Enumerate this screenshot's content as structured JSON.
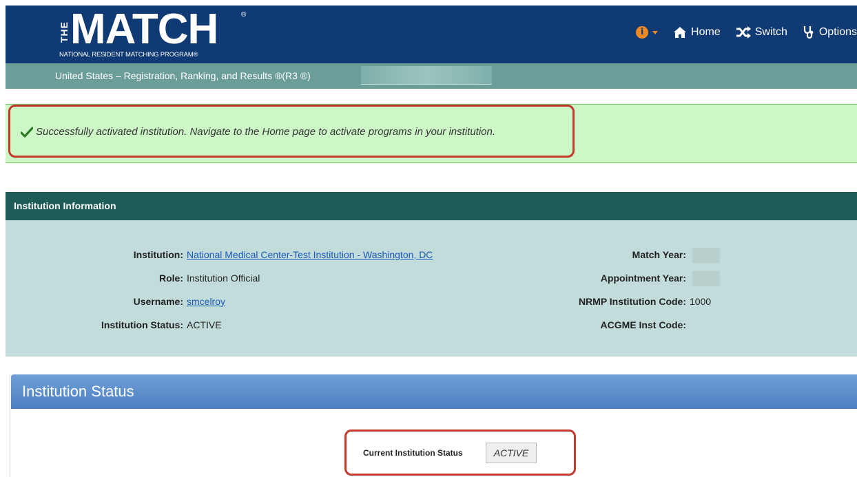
{
  "header": {
    "logo_the": "THE",
    "logo_match": "MATCH",
    "logo_reg": "®",
    "logo_subtitle": "NATIONAL RESIDENT MATCHING PROGRAM®",
    "nav": {
      "home": "Home",
      "switch": "Switch",
      "options": "Options"
    }
  },
  "subheader": {
    "text": "United States  – Registration, Ranking, and Results ®(R3 ®)"
  },
  "alert": {
    "message": "Successfully activated institution. Navigate to the Home page to activate programs in your institution."
  },
  "institution_info": {
    "title": "Institution Information",
    "left": [
      {
        "label": "Institution:",
        "value": "National Medical Center-Test Institution - Washington, DC",
        "link": true
      },
      {
        "label": "Role:",
        "value": "Institution Official",
        "link": false
      },
      {
        "label": "Username:",
        "value": "smcelroy",
        "link": true
      },
      {
        "label": "Institution Status:",
        "value": "ACTIVE",
        "link": false
      }
    ],
    "right": [
      {
        "label": "Match Year:",
        "value": ""
      },
      {
        "label": "Appointment Year:",
        "value": ""
      },
      {
        "label": "NRMP Institution Code:",
        "value": "1000"
      },
      {
        "label": "ACGME Inst Code:",
        "value": ""
      }
    ]
  },
  "institution_status": {
    "title": "Institution Status",
    "current_label": "Current Institution Status",
    "current_value": "ACTIVE"
  },
  "colors": {
    "header_bg": "#0f3a73",
    "subheader_bg": "#6b9e99",
    "alert_bg": "#cdf7c7",
    "panel_header_bg": "#1d5b57",
    "panel_body_bg": "#c2dcdb",
    "status_header_bg": "#5b8ccb",
    "highlight_outline": "#c0392b",
    "info_icon": "#f08a24"
  }
}
